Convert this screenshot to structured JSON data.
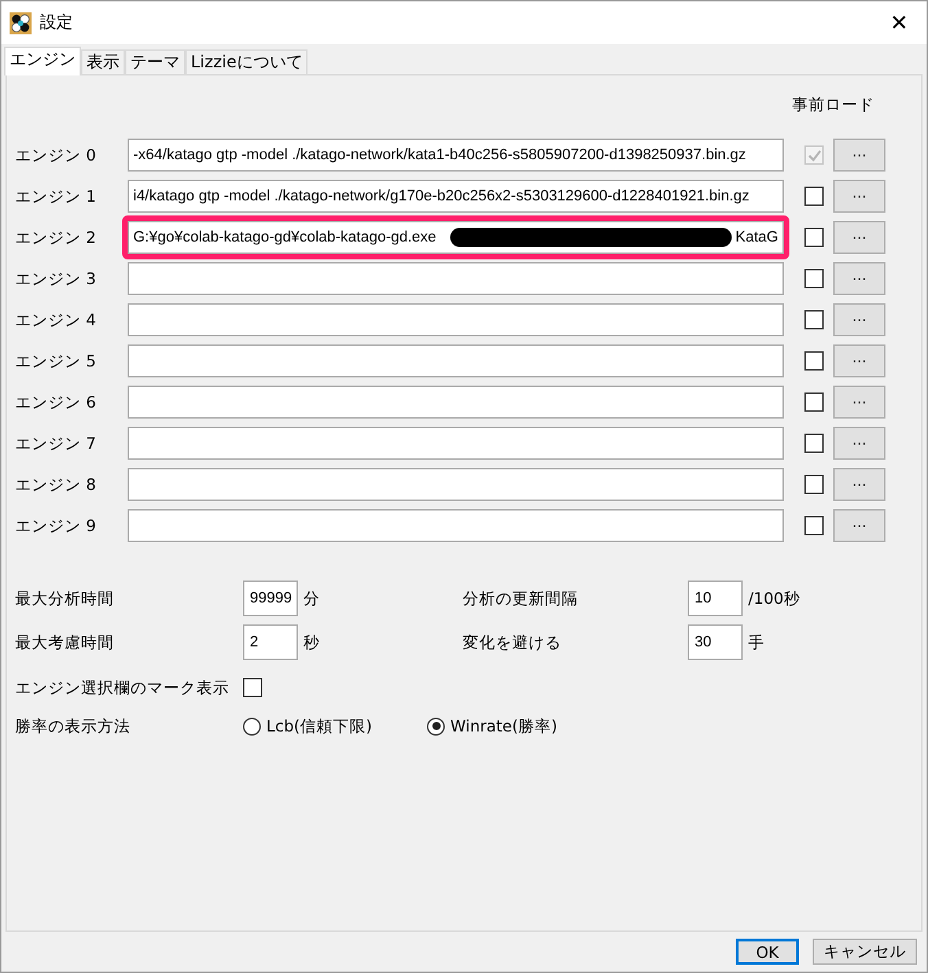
{
  "window": {
    "title": "設定",
    "close": "✕"
  },
  "tabs": [
    {
      "label": "エンジン",
      "selected": true
    },
    {
      "label": "表示",
      "selected": false
    },
    {
      "label": "テーマ",
      "selected": false
    },
    {
      "label": "Lizzieについて",
      "selected": false
    }
  ],
  "preload_header": "事前ロード",
  "engines": [
    {
      "label": "エンジン 0",
      "value": "-x64/katago gtp -model ./katago-network/kata1-b40c256-s5805907200-d1398250937.bin.gz",
      "preload": true,
      "preload_disabled": true,
      "highlighted": false,
      "button": "..."
    },
    {
      "label": "エンジン 1",
      "value": "i4/katago gtp -model ./katago-network/g170e-b20c256x2-s5303129600-d1228401921.bin.gz",
      "preload": false,
      "preload_disabled": false,
      "highlighted": false,
      "button": "..."
    },
    {
      "label": "エンジン 2",
      "value": "G:¥go¥colab-katago-gd¥colab-katago-gd.exe",
      "redacted": true,
      "value_end": "KataG",
      "preload": false,
      "preload_disabled": false,
      "highlighted": true,
      "button": "..."
    },
    {
      "label": "エンジン 3",
      "preload": false,
      "preload_disabled": false,
      "highlighted": false,
      "button": "..."
    },
    {
      "label": "エンジン 4",
      "preload": false,
      "preload_disabled": false,
      "highlighted": false,
      "button": "..."
    },
    {
      "label": "エンジン 5",
      "preload": false,
      "preload_disabled": false,
      "highlighted": false,
      "button": "..."
    },
    {
      "label": "エンジン 6",
      "preload": false,
      "preload_disabled": false,
      "highlighted": false,
      "button": "..."
    },
    {
      "label": "エンジン 7",
      "preload": false,
      "preload_disabled": false,
      "highlighted": false,
      "button": "..."
    },
    {
      "label": "エンジン 8",
      "preload": false,
      "preload_disabled": false,
      "highlighted": false,
      "button": "..."
    },
    {
      "label": "エンジン 9",
      "preload": false,
      "preload_disabled": false,
      "highlighted": false,
      "button": "..."
    }
  ],
  "settings": [
    {
      "label": "最大分析時間",
      "value": "99999",
      "unit": "分"
    },
    {
      "label": "分析の更新間隔",
      "value": "10",
      "unit": "/100秒"
    },
    {
      "label": "最大考慮時間",
      "value": "2",
      "unit": "秒"
    },
    {
      "label": "変化を避ける",
      "value": "30",
      "unit": "手"
    }
  ],
  "mark_display": {
    "label": "エンジン選択欄のマーク表示",
    "checked": false
  },
  "winrate_display": {
    "label": "勝率の表示方法",
    "options": [
      {
        "label": "Lcb(信頼下限)",
        "selected": false
      },
      {
        "label": "Winrate(勝率)",
        "selected": true
      }
    ]
  },
  "buttons": [
    {
      "label": "OK",
      "default": true
    },
    {
      "label": "キャンセル",
      "default": false
    }
  ]
}
